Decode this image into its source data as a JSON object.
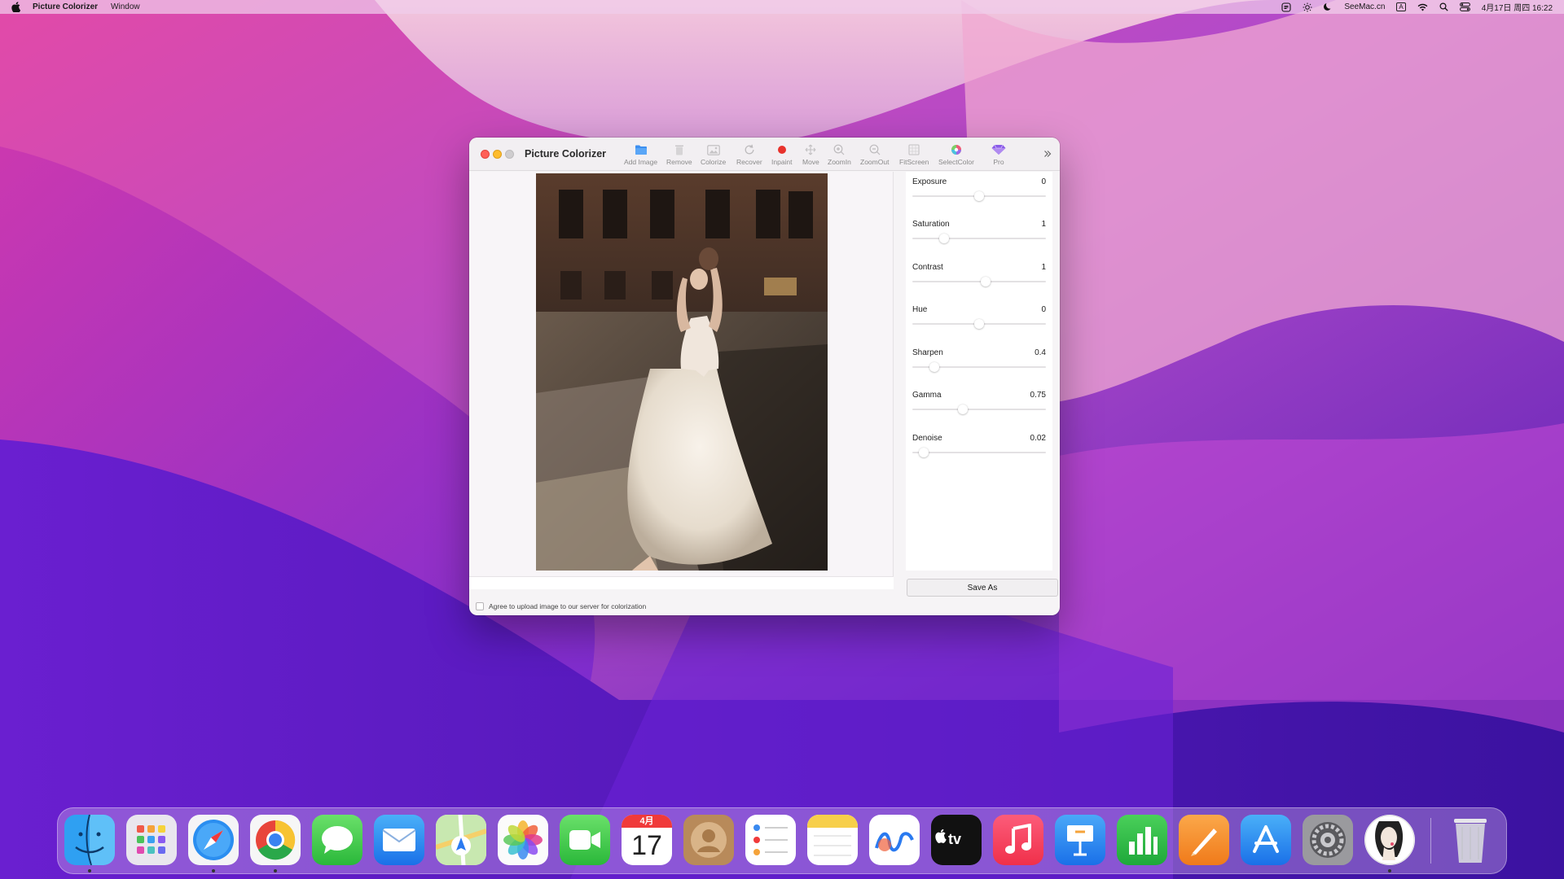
{
  "menubar": {
    "app_name": "Picture Colorizer",
    "window_menu": "Window",
    "site": "SeeMac.cn",
    "input_method": "A",
    "datetime": "4月17日 周四  16:22"
  },
  "window": {
    "title": "Picture Colorizer",
    "toolbar": [
      {
        "label": "Add Image",
        "icon": "folder-icon"
      },
      {
        "label": "Remove",
        "icon": "trash-icon"
      },
      {
        "label": "Colorize",
        "icon": "image-icon"
      },
      {
        "label": "Recover",
        "icon": "recover-icon"
      },
      {
        "label": "Inpaint",
        "icon": "record-dot-icon"
      },
      {
        "label": "Move",
        "icon": "move-icon"
      },
      {
        "label": "ZoomIn",
        "icon": "zoom-in-icon"
      },
      {
        "label": "ZoomOut",
        "icon": "zoom-out-icon"
      },
      {
        "label": "FitScreen",
        "icon": "fit-screen-icon"
      },
      {
        "label": "SelectColor",
        "icon": "color-wheel-icon"
      },
      {
        "label": "Pro",
        "icon": "diamond-icon"
      }
    ],
    "adjustments": [
      {
        "name": "Exposure",
        "value": "0",
        "position": 0.5
      },
      {
        "name": "Saturation",
        "value": "1",
        "position": 0.22
      },
      {
        "name": "Contrast",
        "value": "1",
        "position": 0.55
      },
      {
        "name": "Hue",
        "value": "0",
        "position": 0.5
      },
      {
        "name": "Sharpen",
        "value": "0.4",
        "position": 0.14
      },
      {
        "name": "Gamma",
        "value": "0.75",
        "position": 0.37
      },
      {
        "name": "Denoise",
        "value": "0.02",
        "position": 0.05
      }
    ],
    "save_label": "Save As",
    "agree_label": "Agree to upload image to our server for colorization"
  },
  "calendar": {
    "month": "4月",
    "day": "17"
  },
  "dock": {
    "apps": [
      "Finder",
      "Launchpad",
      "Safari",
      "Chrome",
      "Messages",
      "Mail",
      "Maps",
      "Photos",
      "FaceTime",
      "Calendar",
      "Contacts",
      "Reminders",
      "Notes",
      "Freeform",
      "Apple TV",
      "Music",
      "Keynote",
      "Numbers",
      "Pages",
      "App Store",
      "System Settings",
      "Picture Colorizer",
      "Trash"
    ]
  },
  "colors": {
    "close": "#ff5f57",
    "minimize": "#febc2e",
    "zoom": "#cfcdcf",
    "accent": "#3d8ff0",
    "inpaint": "#e8322c"
  }
}
